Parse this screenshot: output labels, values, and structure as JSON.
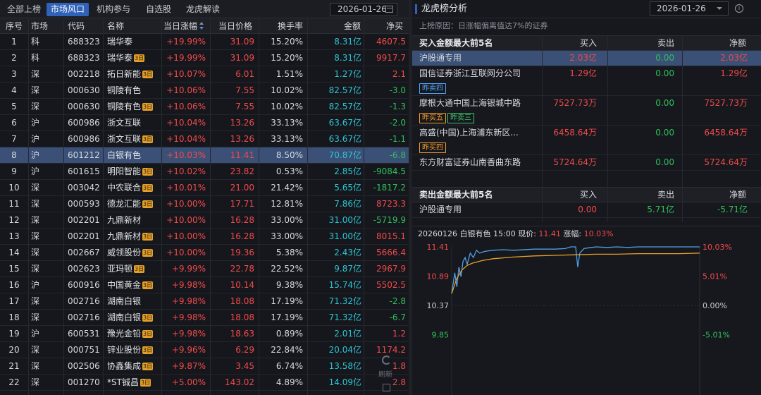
{
  "tabs": [
    {
      "label": "全部上榜",
      "active": false
    },
    {
      "label": "市场风口",
      "active": true
    },
    {
      "label": "机构参与",
      "active": false
    },
    {
      "label": "自选股",
      "active": false
    },
    {
      "label": "龙虎解读",
      "active": false
    }
  ],
  "left_date": "2026-01-26",
  "columns": [
    "序号",
    "市场",
    "代码",
    "名称",
    "当日涨幅",
    "当日价格",
    "换手率",
    "金额",
    "净买"
  ],
  "badge_label": "3日",
  "stocks": [
    {
      "idx": "1",
      "mkt": "科",
      "code": "688323",
      "name": "瑞华泰",
      "badge": false,
      "chg": "+19.99%",
      "price": "31.09",
      "turn": "15.20%",
      "amt": "8.31亿",
      "net": "4607.5",
      "net_dir": "up"
    },
    {
      "idx": "2",
      "mkt": "科",
      "code": "688323",
      "name": "瑞华泰",
      "badge": true,
      "chg": "+19.99%",
      "price": "31.09",
      "turn": "15.20%",
      "amt": "8.31亿",
      "net": "9917.7",
      "net_dir": "up"
    },
    {
      "idx": "3",
      "mkt": "深",
      "code": "002218",
      "name": "拓日新能",
      "badge": true,
      "chg": "+10.07%",
      "price": "6.01",
      "turn": "1.51%",
      "amt": "1.27亿",
      "net": "2.1",
      "net_dir": "up"
    },
    {
      "idx": "4",
      "mkt": "深",
      "code": "000630",
      "name": "铜陵有色",
      "badge": false,
      "chg": "+10.06%",
      "price": "7.55",
      "turn": "10.02%",
      "amt": "82.57亿",
      "net": "-3.0",
      "net_dir": "down"
    },
    {
      "idx": "5",
      "mkt": "深",
      "code": "000630",
      "name": "铜陵有色",
      "badge": true,
      "chg": "+10.06%",
      "price": "7.55",
      "turn": "10.02%",
      "amt": "82.57亿",
      "net": "-1.3",
      "net_dir": "down"
    },
    {
      "idx": "6",
      "mkt": "沪",
      "code": "600986",
      "name": "浙文互联",
      "badge": false,
      "chg": "+10.04%",
      "price": "13.26",
      "turn": "33.13%",
      "amt": "63.67亿",
      "net": "-2.0",
      "net_dir": "down"
    },
    {
      "idx": "7",
      "mkt": "沪",
      "code": "600986",
      "name": "浙文互联",
      "badge": true,
      "chg": "+10.04%",
      "price": "13.26",
      "turn": "33.13%",
      "amt": "63.67亿",
      "net": "-1.1",
      "net_dir": "down"
    },
    {
      "idx": "8",
      "mkt": "沪",
      "code": "601212",
      "name": "白银有色",
      "badge": false,
      "chg": "+10.03%",
      "price": "11.41",
      "turn": "8.50%",
      "amt": "70.87亿",
      "net": "-6.8",
      "net_dir": "down"
    },
    {
      "idx": "9",
      "mkt": "沪",
      "code": "601615",
      "name": "明阳智能",
      "badge": true,
      "chg": "+10.02%",
      "price": "23.82",
      "turn": "0.53%",
      "amt": "2.85亿",
      "net": "-9084.5",
      "net_dir": "down"
    },
    {
      "idx": "10",
      "mkt": "深",
      "code": "003042",
      "name": "中农联合",
      "badge": true,
      "chg": "+10.01%",
      "price": "21.00",
      "turn": "21.42%",
      "amt": "5.65亿",
      "net": "-1817.2",
      "net_dir": "down"
    },
    {
      "idx": "11",
      "mkt": "深",
      "code": "000593",
      "name": "德龙汇能",
      "badge": true,
      "chg": "+10.00%",
      "price": "17.71",
      "turn": "12.81%",
      "amt": "7.86亿",
      "net": "8723.3",
      "net_dir": "up"
    },
    {
      "idx": "12",
      "mkt": "深",
      "code": "002201",
      "name": "九鼎新材",
      "badge": false,
      "chg": "+10.00%",
      "price": "16.28",
      "turn": "33.00%",
      "amt": "31.00亿",
      "net": "-5719.9",
      "net_dir": "down"
    },
    {
      "idx": "13",
      "mkt": "深",
      "code": "002201",
      "name": "九鼎新材",
      "badge": true,
      "chg": "+10.00%",
      "price": "16.28",
      "turn": "33.00%",
      "amt": "31.00亿",
      "net": "8015.1",
      "net_dir": "up"
    },
    {
      "idx": "14",
      "mkt": "深",
      "code": "002667",
      "name": "威领股份",
      "badge": true,
      "chg": "+10.00%",
      "price": "19.36",
      "turn": "5.38%",
      "amt": "2.43亿",
      "net": "5666.4",
      "net_dir": "up"
    },
    {
      "idx": "15",
      "mkt": "深",
      "code": "002623",
      "name": "亚玛顿",
      "badge": true,
      "chg": "+9.99%",
      "price": "22.78",
      "turn": "22.52%",
      "amt": "9.87亿",
      "net": "2967.9",
      "net_dir": "up"
    },
    {
      "idx": "16",
      "mkt": "沪",
      "code": "600916",
      "name": "中国黄金",
      "badge": true,
      "chg": "+9.98%",
      "price": "10.14",
      "turn": "9.38%",
      "amt": "15.74亿",
      "net": "5502.5",
      "net_dir": "up"
    },
    {
      "idx": "17",
      "mkt": "深",
      "code": "002716",
      "name": "湖南白银",
      "badge": false,
      "chg": "+9.98%",
      "price": "18.08",
      "turn": "17.19%",
      "amt": "71.32亿",
      "net": "-2.8",
      "net_dir": "down"
    },
    {
      "idx": "18",
      "mkt": "深",
      "code": "002716",
      "name": "湖南白银",
      "badge": true,
      "chg": "+9.98%",
      "price": "18.08",
      "turn": "17.19%",
      "amt": "71.32亿",
      "net": "-6.7",
      "net_dir": "down"
    },
    {
      "idx": "19",
      "mkt": "沪",
      "code": "600531",
      "name": "豫光金铅",
      "badge": true,
      "chg": "+9.98%",
      "price": "18.63",
      "turn": "0.89%",
      "amt": "2.01亿",
      "net": "1.2",
      "net_dir": "up"
    },
    {
      "idx": "20",
      "mkt": "深",
      "code": "000751",
      "name": "锌业股份",
      "badge": true,
      "chg": "+9.96%",
      "price": "6.29",
      "turn": "22.84%",
      "amt": "20.04亿",
      "net": "1174.2",
      "net_dir": "up"
    },
    {
      "idx": "21",
      "mkt": "深",
      "code": "002506",
      "name": "协鑫集成",
      "badge": true,
      "chg": "+9.87%",
      "price": "3.45",
      "turn": "6.74%",
      "amt": "13.58亿",
      "net": "1.8",
      "net_dir": "up"
    },
    {
      "idx": "22",
      "mkt": "深",
      "code": "001270",
      "name": "*ST铖昌",
      "badge": true,
      "chg": "+5.00%",
      "price": "143.02",
      "turn": "4.89%",
      "amt": "14.09亿",
      "net": "2.8",
      "net_dir": "up"
    }
  ],
  "selected_row": 7,
  "refresh_label": "刷新",
  "right": {
    "title": "龙虎榜分析",
    "date": "2026-01-26",
    "info_glyph": "i",
    "reason": "上榜原因：日涨幅偏离值达7%的证券",
    "buy_section": {
      "title": "买入金额最大前5名",
      "col_buy": "买入",
      "col_sell": "卖出",
      "col_net": "净额",
      "rows": [
        {
          "name": "沪股通专用",
          "buy": "2.03亿",
          "sell": "0.00",
          "net": "2.03亿",
          "net_dir": "up",
          "tags": []
        },
        {
          "name": "国信证券浙江互联网分公司",
          "buy": "1.29亿",
          "sell": "0.00",
          "net": "1.29亿",
          "net_dir": "up",
          "tags": [
            {
              "text": "昨卖四",
              "color": "blue"
            }
          ]
        },
        {
          "name": "摩根大通中国上海银城中路",
          "buy": "7527.73万",
          "sell": "0.00",
          "net": "7527.73万",
          "net_dir": "up",
          "tags": [
            {
              "text": "昨买五",
              "color": "orange"
            },
            {
              "text": "昨卖三",
              "color": "green"
            }
          ]
        },
        {
          "name": "高盛(中国)上海浦东新区...",
          "buy": "6458.64万",
          "sell": "0.00",
          "net": "6458.64万",
          "net_dir": "up",
          "tags": [
            {
              "text": "昨买四",
              "color": "orange"
            }
          ]
        },
        {
          "name": "东方财富证券山南香曲东路",
          "buy": "5724.64万",
          "sell": "0.00",
          "net": "5724.64万",
          "net_dir": "up",
          "tags": []
        }
      ]
    },
    "sell_section": {
      "title": "卖出金额最大前5名",
      "col_buy": "买入",
      "col_sell": "卖出",
      "col_net": "净额",
      "rows": [
        {
          "name": "沪股通专用",
          "buy": "0.00",
          "sell": "5.71亿",
          "net": "-5.71亿",
          "net_dir": "down",
          "tags": []
        }
      ]
    },
    "chart_header": {
      "date": "20260126",
      "name": "白银有色",
      "time": "15:00",
      "price_label": "现价:",
      "price": "11.41",
      "chg_label": "涨幅:",
      "chg": "10.03%"
    }
  },
  "chart_data": {
    "type": "line",
    "title": "",
    "xlabel": "",
    "ylabel": "",
    "y_ticks_left": [
      "11.41",
      "10.89",
      "10.37",
      "9.85"
    ],
    "y_ticks_right": [
      "10.03%",
      "5.01%",
      "0.00%",
      "-5.01%"
    ],
    "ylim": [
      9.33,
      11.41
    ],
    "prev_close": 10.37,
    "x_range": [
      0,
      240
    ],
    "grid": false,
    "series": [
      {
        "color": "#4f9fe8",
        "x": [
          0,
          3,
          5,
          7,
          9,
          11,
          13,
          15,
          18,
          21,
          24,
          27,
          32,
          40,
          50,
          60,
          80,
          100,
          110,
          115,
          118,
          120,
          122,
          124,
          128,
          135,
          140,
          150,
          160,
          170,
          180,
          190,
          200,
          210,
          220,
          230,
          240
        ],
        "values": [
          10.58,
          10.95,
          10.7,
          11.05,
          10.88,
          11.15,
          11.22,
          11.1,
          11.3,
          11.22,
          11.35,
          11.3,
          11.33,
          11.35,
          11.36,
          11.35,
          11.37,
          11.37,
          11.38,
          11.41,
          11.41,
          11.41,
          11.05,
          11.3,
          11.38,
          11.4,
          11.41,
          11.4,
          11.41,
          11.4,
          11.41,
          11.41,
          11.41,
          11.41,
          11.41,
          11.41,
          11.41
        ]
      },
      {
        "color": "#e5a02b",
        "x": [
          0,
          5,
          10,
          15,
          20,
          30,
          40,
          60,
          80,
          100,
          120,
          140,
          160,
          180,
          200,
          220,
          240
        ],
        "values": [
          10.58,
          10.85,
          11.0,
          11.08,
          11.12,
          11.17,
          11.2,
          11.23,
          11.25,
          11.26,
          11.27,
          11.28,
          11.28,
          11.29,
          11.29,
          11.29,
          11.3
        ]
      }
    ]
  }
}
